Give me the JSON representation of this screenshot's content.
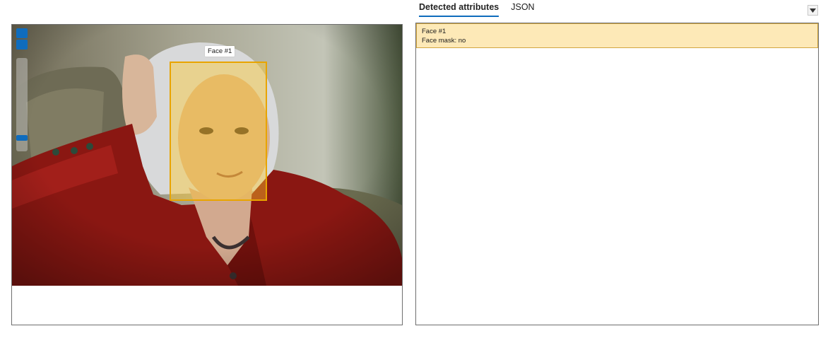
{
  "tabs": [
    {
      "label": "Detected attributes",
      "active": true
    },
    {
      "label": "JSON",
      "active": false
    }
  ],
  "viewer": {
    "face_label": "Face #1",
    "zoom_level": 0.12
  },
  "results": {
    "items": [
      {
        "title": "Face #1",
        "attribute": "Face mask: no"
      }
    ]
  },
  "colors": {
    "accent": "#0f6cbd",
    "face_box": "#e8a400",
    "result_highlight": "#fde9b7"
  },
  "icons": {
    "dropdown": "chevron-down-icon"
  }
}
